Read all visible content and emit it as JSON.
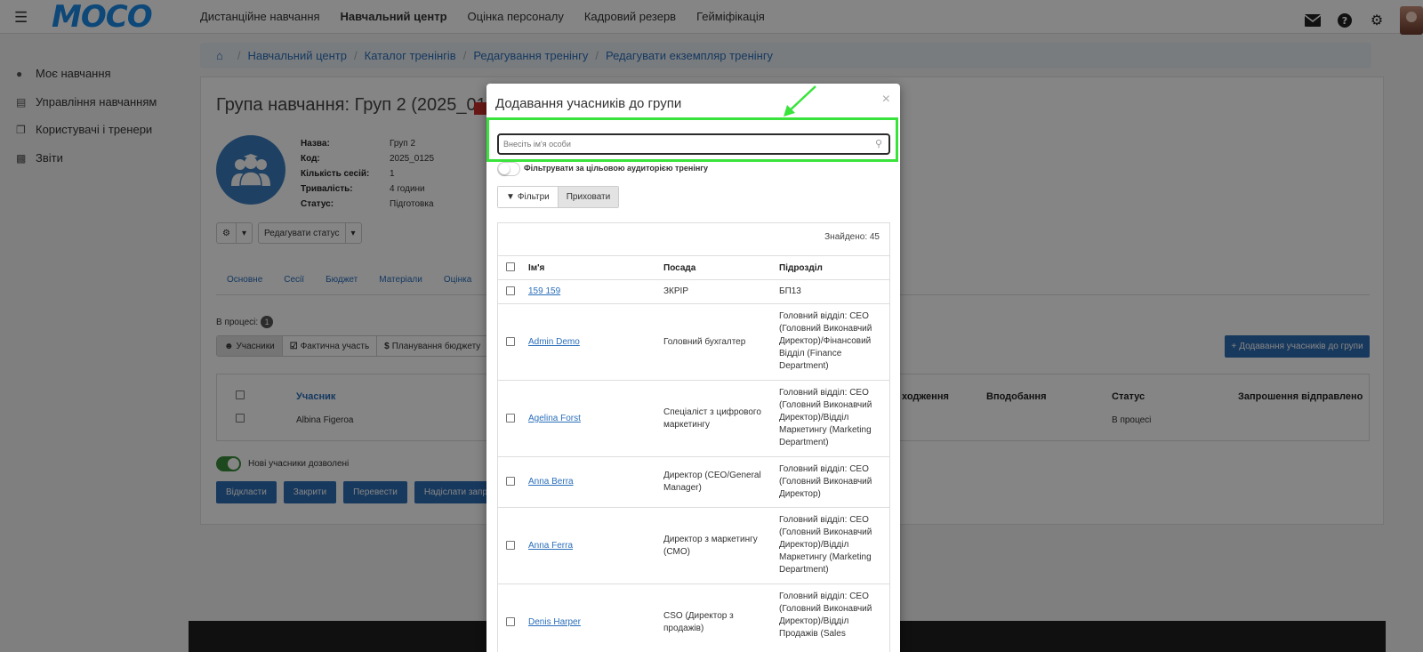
{
  "nav": {
    "logo": "MOCO",
    "items": [
      "Дистанційне навчання",
      "Навчальний центр",
      "Оцінка персоналу",
      "Кадровий резерв",
      "Гейміфікація"
    ],
    "active_index": 1
  },
  "sidebar": {
    "items": [
      {
        "label": "Моє навчання",
        "icon": "moneybag-icon"
      },
      {
        "label": "Управління навчанням",
        "icon": "training-management-icon"
      },
      {
        "label": "Користувачі і тренери",
        "icon": "users-icon"
      },
      {
        "label": "Звіти",
        "icon": "bar-chart-icon"
      }
    ]
  },
  "breadcrumb": [
    "Навчальний центр",
    "Каталог тренінгів",
    "Редагування тренінгу",
    "Редагувати екземпляр тренінгу"
  ],
  "page": {
    "title": "Група навчання: Груп 2 (2025_0125)",
    "info": [
      {
        "label": "Назва:",
        "value": "Груп 2"
      },
      {
        "label": "Код:",
        "value": "2025_0125"
      },
      {
        "label": "Кількість сесій:",
        "value": "1"
      },
      {
        "label": "Тривалість:",
        "value": "4 години"
      },
      {
        "label": "Статус:",
        "value": "Підготовка"
      }
    ],
    "edit_status_label": "Редагувати статус",
    "tabs": [
      "Основне",
      "Сесії",
      "Бюджет",
      "Матеріали",
      "Оцінка"
    ],
    "in_process_label": "В процесі:",
    "in_process_count": "1",
    "subtabs": [
      "Учасники",
      "Фактична участь",
      "Планування бюджету"
    ],
    "add_participants_label": "Додавання учасників до групи",
    "participants_table": {
      "headers": [
        "Учасник",
        "ходження",
        "Вподобання",
        "Статус",
        "Запрошення відправлено"
      ],
      "rows": [
        {
          "name": "Albina Figeroa",
          "status": "В процесі"
        }
      ]
    },
    "new_participants_label": "Нові учасники дозволені",
    "action_buttons": [
      "Відкласти",
      "Закрити",
      "Перевести",
      "Надіслати запроше"
    ]
  },
  "modal": {
    "title": "Додавання учасників до групи",
    "close": "×",
    "search_placeholder": "Внесіть ім'я особи",
    "filter_toggle_label": "Фільтрувати за цільовою аудиторією тренінгу",
    "filters_label": "Фільтри",
    "hide_label": "Приховати",
    "found_label": "Знайдено: 45",
    "columns": [
      "Ім'я",
      "Посада",
      "Підрозділ"
    ],
    "rows": [
      {
        "name": "159 159",
        "position": "ЗКРІР",
        "department": "БП13"
      },
      {
        "name": "Admin Demo",
        "position": "Головний бухгалтер",
        "department": "Головний відділ: CEO (Головний Виконавчий Директор)/Фінансовий Відділ (Finance Department)"
      },
      {
        "name": "Agelina Forst",
        "position": "Спеціаліст з цифрового маркетингу",
        "department": "Головний відділ: CEO (Головний Виконавчий Директор)/Відділ Маркетингу (Marketing Department)"
      },
      {
        "name": "Anna Berra",
        "position": "Директор (CEO/General Manager)",
        "department": "Головний відділ: CEO (Головний Виконавчий Директор)"
      },
      {
        "name": "Anna Ferra",
        "position": "Директор з маркетингу (CMO)",
        "department": "Головний відділ: CEO (Головний Виконавчий Директор)/Відділ Маркетингу (Marketing Department)"
      },
      {
        "name": "Denis Harper",
        "position": "CSO (Директор з продажів)",
        "department": "Головний відділ: CEO (Головний Виконавчий Директор)/Відділ Продажів (Sales"
      }
    ]
  },
  "colors": {
    "brand": "#1a8be8",
    "primary_button": "#2e6db4",
    "highlight": "#39e33c",
    "link": "#2a6ebb"
  }
}
